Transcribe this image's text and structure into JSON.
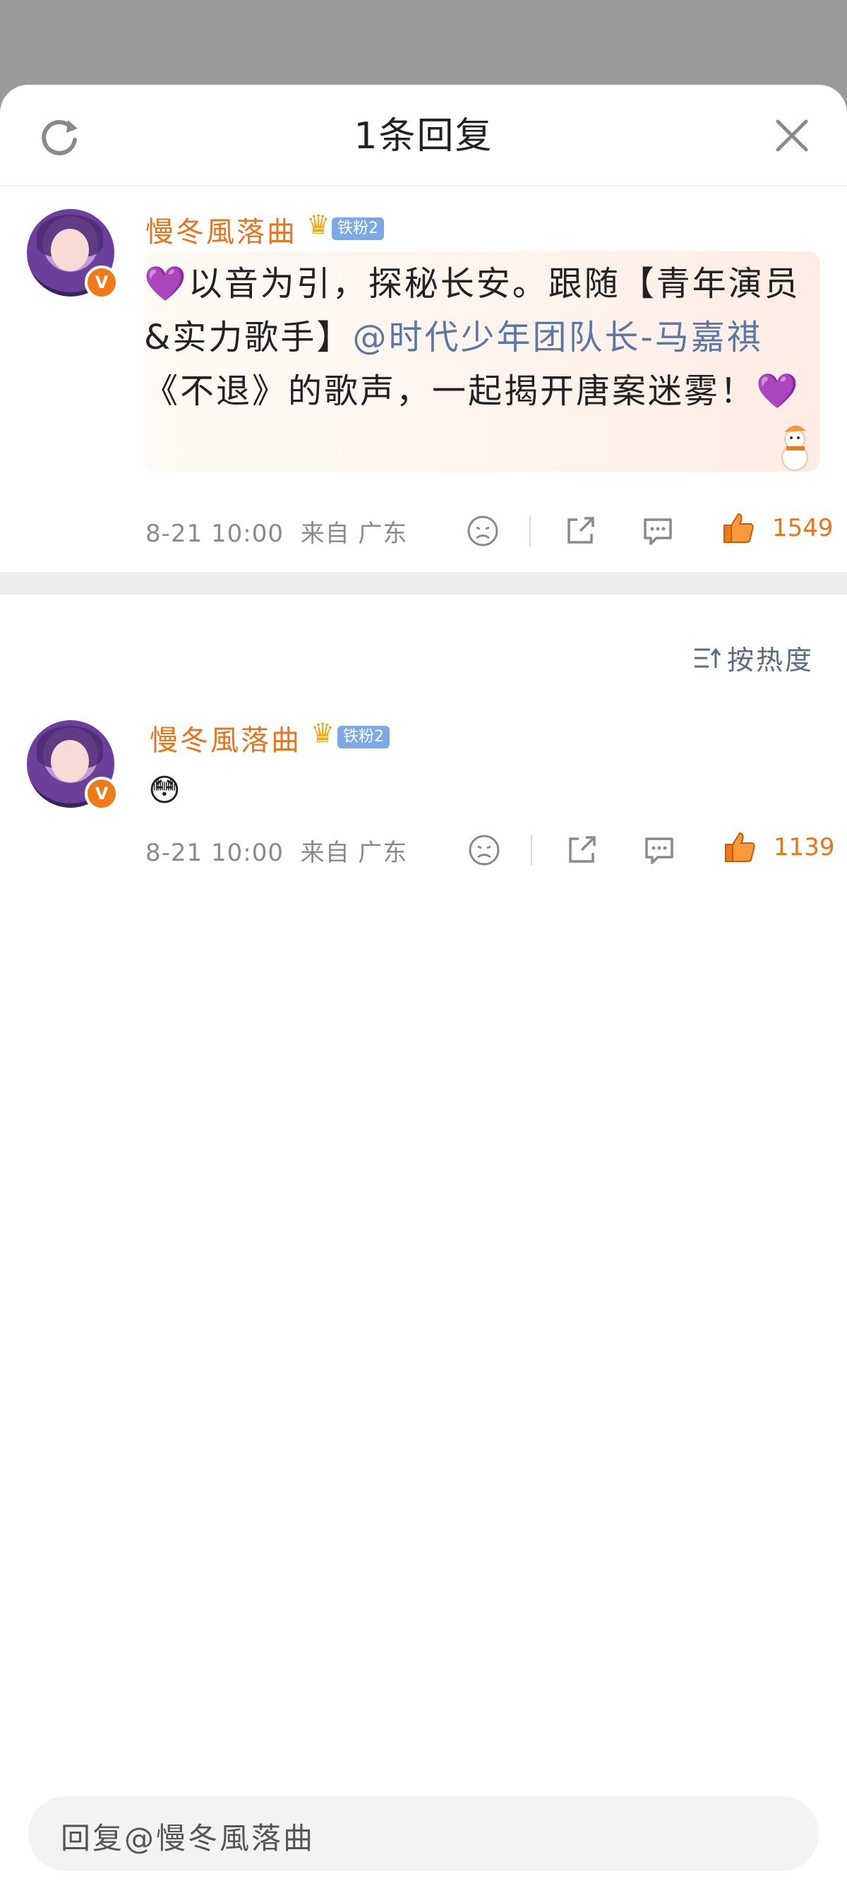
{
  "header": {
    "title": "1条回复",
    "refresh_icon": "refresh-icon",
    "close_icon": "close-icon"
  },
  "main_comment": {
    "username": "慢冬風落曲",
    "fan_badge": "铁粉2",
    "text_prefix": "以音为引，探秘长安。跟随【青年演员&实力歌手】",
    "mention": "@时代少年团队长-马嘉祺",
    "text_suffix": "《不退》的歌声，一起揭开唐案迷雾！",
    "emoji_heart": "💜",
    "timestamp": "8-21 10:00",
    "location": "来自 广东",
    "likes": "1549"
  },
  "sort": {
    "label": "按热度"
  },
  "reply_comment": {
    "username": "慢冬風落曲",
    "fan_badge": "铁粉2",
    "text": "😳",
    "timestamp": "8-21 10:00",
    "location": "来自 广东",
    "likes": "1139"
  },
  "reply_input": {
    "placeholder": "回复@慢冬風落曲"
  },
  "colors": {
    "accent_orange": "#e9741b",
    "mention_blue": "#5878a8",
    "badge_blue": "#7aa9e6"
  }
}
